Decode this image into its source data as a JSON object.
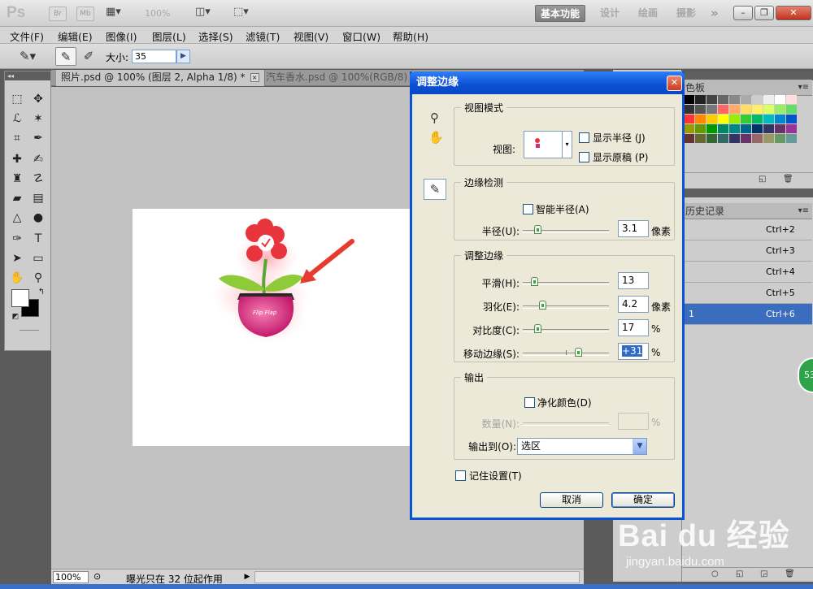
{
  "appbar": {
    "logo": "Ps",
    "br": "Br",
    "mb": "Mb",
    "zoom": "100%",
    "workspaces": [
      "基本功能",
      "设计",
      "绘画",
      "摄影"
    ],
    "more": "»"
  },
  "menu": [
    "文件(F)",
    "编辑(E)",
    "图像(I)",
    "图层(L)",
    "选择(S)",
    "滤镜(T)",
    "视图(V)",
    "窗口(W)",
    "帮助(H)"
  ],
  "options": {
    "size_label": "大小:",
    "size_value": "35"
  },
  "tabs": [
    {
      "label": "照片.psd @ 100% (图层 2, Alpha 1/8) *"
    },
    {
      "label": "汽车香水.psd @ 100%(RGB/8)"
    }
  ],
  "status": {
    "zoom": "100%",
    "info": "曝光只在 32 位起作用"
  },
  "panels": {
    "swatches_tab": "色板",
    "history_tab": "历史记录",
    "history": [
      {
        "name": "",
        "key": "Ctrl+2"
      },
      {
        "name": "",
        "key": "Ctrl+3"
      },
      {
        "name": "",
        "key": "Ctrl+4"
      },
      {
        "name": "",
        "key": "Ctrl+5"
      },
      {
        "name": "1",
        "key": "Ctrl+6"
      }
    ],
    "badge": "53"
  },
  "dialog": {
    "title": "调整边缘",
    "view_mode": {
      "legend": "视图模式",
      "view_label": "视图:",
      "show_radius": "显示半径 (J)",
      "show_original": "显示原稿 (P)"
    },
    "edge_detection": {
      "legend": "边缘检测",
      "smart_radius": "智能半径(A)",
      "radius_label": "半径(U):",
      "radius_value": "3.1",
      "radius_unit": "像素"
    },
    "adjust_edge": {
      "legend": "调整边缘",
      "smooth_label": "平滑(H):",
      "smooth_value": "13",
      "feather_label": "羽化(E):",
      "feather_value": "4.2",
      "feather_unit": "像素",
      "contrast_label": "对比度(C):",
      "contrast_value": "17",
      "contrast_unit": "%",
      "shift_label": "移动边缘(S):",
      "shift_value": "+31",
      "shift_unit": "%"
    },
    "output": {
      "legend": "输出",
      "decontaminate": "净化颜色(D)",
      "amount_label": "数量(N):",
      "amount_unit": "%",
      "output_to_label": "输出到(O):",
      "output_to_value": "选区"
    },
    "remember": "记住设置(T)",
    "cancel": "取消",
    "ok": "确定"
  },
  "watermark": {
    "text": "Bai du 经验",
    "url": "jingyan.baidu.com"
  }
}
